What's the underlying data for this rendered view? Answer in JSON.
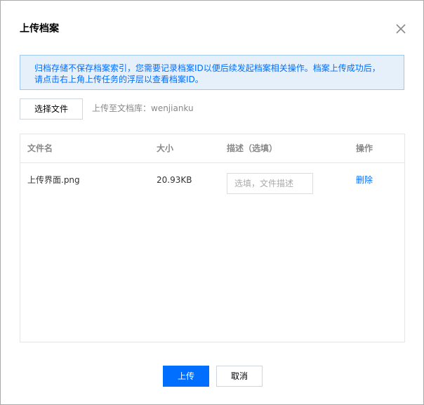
{
  "dialog": {
    "title": "上传档案",
    "close_icon": "close-icon"
  },
  "notice": {
    "line1": "归档存储不保存档案索引，您需要记录档案ID以便后续发起档案相关操作。档案上传成功后，",
    "line2": "请点击右上角上传任务的浮层以查看档案ID。",
    "background": "#e5f0fb",
    "text_color": "#006eff"
  },
  "toolbar": {
    "select_button": "选择文件",
    "upload_target": "上传至文档库：wenjianku"
  },
  "table": {
    "columns": [
      "文件名",
      "大小",
      "描述（选填）",
      "操作"
    ],
    "rows": [
      {
        "filename": "上传界面.png",
        "size": "20.93KB",
        "description_placeholder": "选填，文件描述",
        "description_value": "",
        "action": "删除"
      }
    ]
  },
  "footer": {
    "upload_button": "上传",
    "cancel_button": "取消",
    "accent": "#006eff"
  }
}
